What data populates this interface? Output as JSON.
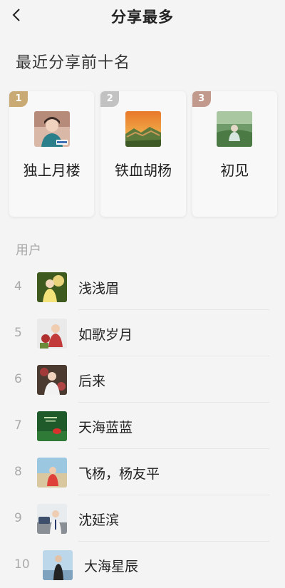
{
  "header": {
    "title": "分享最多",
    "back_icon": "chevron-left-icon"
  },
  "top_section": {
    "title": "最近分享前十名"
  },
  "top3": [
    {
      "rank": "1",
      "name": "独上月楼",
      "badge_color": "#c9a974"
    },
    {
      "rank": "2",
      "name": "铁血胡杨",
      "badge_color": "#c2c2c2"
    },
    {
      "rank": "3",
      "name": "初见",
      "badge_color": "#c29a8d"
    }
  ],
  "users_section": {
    "label": "用户"
  },
  "users": [
    {
      "rank": "4",
      "name": "浅浅眉"
    },
    {
      "rank": "5",
      "name": "如歌岁月"
    },
    {
      "rank": "6",
      "name": "后来"
    },
    {
      "rank": "7",
      "name": "天海蓝蓝"
    },
    {
      "rank": "8",
      "name": "飞杨，杨友平"
    },
    {
      "rank": "9",
      "name": "沈延滨"
    },
    {
      "rank": "10",
      "name": "大海星辰"
    }
  ]
}
